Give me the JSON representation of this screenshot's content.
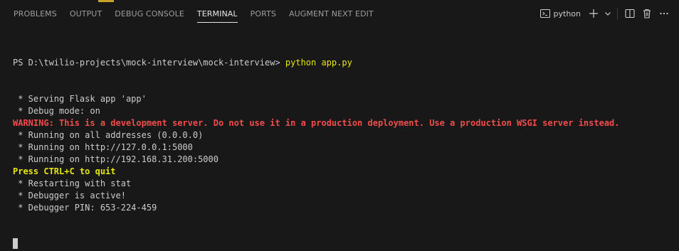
{
  "panel": {
    "tabs": [
      {
        "label": "PROBLEMS",
        "active": false
      },
      {
        "label": "OUTPUT",
        "active": false
      },
      {
        "label": "DEBUG CONSOLE",
        "active": false
      },
      {
        "label": "TERMINAL",
        "active": true
      },
      {
        "label": "PORTS",
        "active": false
      },
      {
        "label": "AUGMENT NEXT EDIT",
        "active": false
      }
    ],
    "terminal_name": "python",
    "icons": [
      "terminal-icon",
      "plus-icon",
      "chevron-down-icon",
      "split-icon",
      "trash-icon",
      "more-icon"
    ]
  },
  "terminal": {
    "prompt": "PS D:\\twilio-projects\\mock-interview\\mock-interview> ",
    "command": "python app.py",
    "lines": [
      {
        "text": " * Serving Flask app 'app'",
        "style": "normal"
      },
      {
        "text": " * Debug mode: on",
        "style": "normal"
      },
      {
        "text": "WARNING: This is a development server. Do not use it in a production deployment. Use a production WSGI server instead.",
        "style": "warning"
      },
      {
        "text": " * Running on all addresses (0.0.0.0)",
        "style": "normal"
      },
      {
        "text": " * Running on http://127.0.0.1:5000",
        "style": "normal"
      },
      {
        "text": " * Running on http://192.168.31.200:5000",
        "style": "normal"
      },
      {
        "text": "Press CTRL+C to quit",
        "style": "yellow-bold"
      },
      {
        "text": " * Restarting with stat",
        "style": "normal"
      },
      {
        "text": " * Debugger is active!",
        "style": "normal"
      },
      {
        "text": " * Debugger PIN: 653-224-459",
        "style": "normal"
      }
    ]
  },
  "colors": {
    "background": "#181818",
    "text": "#cccccc",
    "warning": "#f14c4c",
    "highlight": "#e5e510"
  }
}
